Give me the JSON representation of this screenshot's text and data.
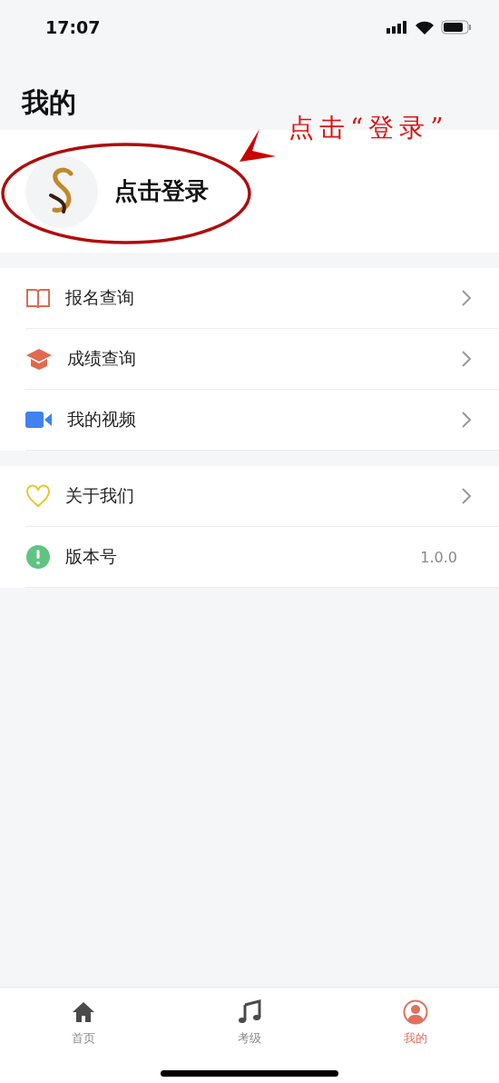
{
  "status_bar": {
    "time": "17:07"
  },
  "title": "我的",
  "profile": {
    "login_label": "点击登录"
  },
  "annotation": {
    "text": "点击“登录”"
  },
  "groups": [
    {
      "items": [
        {
          "kind": "link",
          "label": "报名查询"
        },
        {
          "kind": "link",
          "label": "成绩查询"
        },
        {
          "kind": "link",
          "label": "我的视频"
        }
      ]
    },
    {
      "items": [
        {
          "kind": "link",
          "label": "关于我们"
        },
        {
          "kind": "value",
          "label": "版本号",
          "value": "1.0.0"
        }
      ]
    }
  ],
  "tab_bar": [
    {
      "label": "首页",
      "selected": false
    },
    {
      "label": "考级",
      "selected": false
    },
    {
      "label": "我的",
      "selected": true
    }
  ]
}
